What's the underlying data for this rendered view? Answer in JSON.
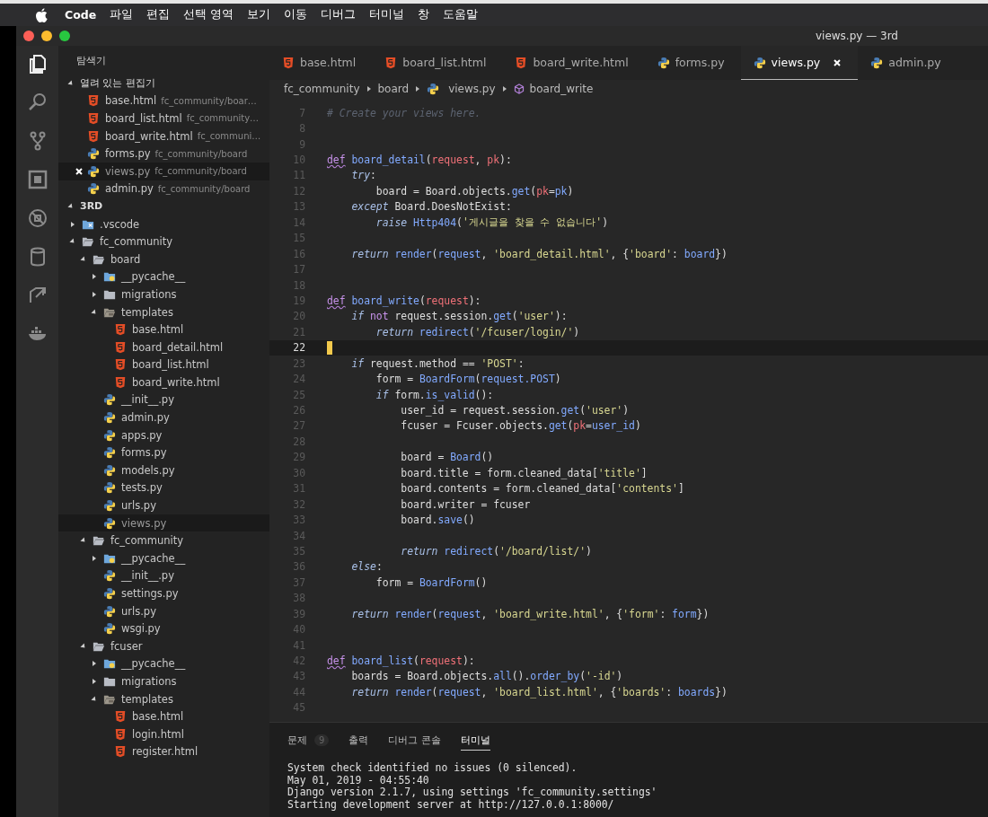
{
  "menu_bar": {
    "items": [
      "Code",
      "파일",
      "편집",
      "선택 영역",
      "보기",
      "이동",
      "디버그",
      "터미널",
      "창",
      "도움말"
    ]
  },
  "window": {
    "title": "views.py — 3rd"
  },
  "activity_bar": [
    {
      "kind": "files",
      "selected": true
    },
    {
      "kind": "search",
      "selected": false
    },
    {
      "kind": "source-control",
      "selected": false
    },
    {
      "kind": "extensions",
      "selected": false
    },
    {
      "kind": "debug",
      "selected": false
    },
    {
      "kind": "database",
      "selected": false
    },
    {
      "kind": "share",
      "selected": false
    },
    {
      "kind": "docker",
      "selected": false
    }
  ],
  "sidebar": {
    "title": "탐색기",
    "open_editors": {
      "label": "열려 있는 편집기",
      "expanded": true,
      "items": [
        {
          "name": "base.html",
          "path": "fc_community/boar…",
          "kind": "html",
          "selected": false
        },
        {
          "name": "board_list.html",
          "path": "fc_community…",
          "kind": "html",
          "selected": false
        },
        {
          "name": "board_write.html",
          "path": "fc_communi…",
          "kind": "html",
          "selected": false
        },
        {
          "name": "forms.py",
          "path": "fc_community/board",
          "kind": "python",
          "selected": false
        },
        {
          "name": "views.py",
          "path": "fc_community/board",
          "kind": "python",
          "selected": true
        },
        {
          "name": "admin.py",
          "path": "fc_community/board",
          "kind": "python",
          "selected": false
        }
      ]
    },
    "workspace": {
      "label": "3RD",
      "expanded": true,
      "children": [
        {
          "name": ".vscode",
          "kind": "folder-vscode",
          "expanded": false,
          "selected": false
        },
        {
          "name": "fc_community",
          "kind": "folder",
          "expanded": true,
          "selected": false,
          "children": [
            {
              "name": "board",
              "kind": "folder",
              "expanded": true,
              "selected": false,
              "children": [
                {
                  "name": "__pycache__",
                  "kind": "folder-python",
                  "expanded": false,
                  "selected": false
                },
                {
                  "name": "migrations",
                  "kind": "folder",
                  "expanded": false,
                  "selected": false
                },
                {
                  "name": "templates",
                  "kind": "folder-templates",
                  "expanded": true,
                  "selected": false,
                  "children": [
                    {
                      "name": "base.html",
                      "kind": "html",
                      "selected": false
                    },
                    {
                      "name": "board_detail.html",
                      "kind": "html",
                      "selected": false
                    },
                    {
                      "name": "board_list.html",
                      "kind": "html",
                      "selected": false
                    },
                    {
                      "name": "board_write.html",
                      "kind": "html",
                      "selected": false
                    }
                  ]
                },
                {
                  "name": "__init__.py",
                  "kind": "python",
                  "selected": false
                },
                {
                  "name": "admin.py",
                  "kind": "python",
                  "selected": false
                },
                {
                  "name": "apps.py",
                  "kind": "python",
                  "selected": false
                },
                {
                  "name": "forms.py",
                  "kind": "python",
                  "selected": false
                },
                {
                  "name": "models.py",
                  "kind": "python",
                  "selected": false
                },
                {
                  "name": "tests.py",
                  "kind": "python",
                  "selected": false
                },
                {
                  "name": "urls.py",
                  "kind": "python",
                  "selected": false
                },
                {
                  "name": "views.py",
                  "kind": "python",
                  "selected": true
                }
              ]
            },
            {
              "name": "fc_community",
              "kind": "folder",
              "expanded": true,
              "selected": false,
              "children": [
                {
                  "name": "__pycache__",
                  "kind": "folder-python",
                  "expanded": false,
                  "selected": false
                },
                {
                  "name": "__init__.py",
                  "kind": "python",
                  "selected": false
                },
                {
                  "name": "settings.py",
                  "kind": "python",
                  "selected": false
                },
                {
                  "name": "urls.py",
                  "kind": "python",
                  "selected": false
                },
                {
                  "name": "wsgi.py",
                  "kind": "python",
                  "selected": false
                }
              ]
            },
            {
              "name": "fcuser",
              "kind": "folder",
              "expanded": true,
              "selected": false,
              "children": [
                {
                  "name": "__pycache__",
                  "kind": "folder-python",
                  "expanded": false,
                  "selected": false
                },
                {
                  "name": "migrations",
                  "kind": "folder",
                  "expanded": false,
                  "selected": false
                },
                {
                  "name": "templates",
                  "kind": "folder-templates",
                  "expanded": true,
                  "selected": false,
                  "children": [
                    {
                      "name": "base.html",
                      "kind": "html",
                      "selected": false
                    },
                    {
                      "name": "login.html",
                      "kind": "html",
                      "selected": false
                    },
                    {
                      "name": "register.html",
                      "kind": "html",
                      "selected": false
                    }
                  ]
                }
              ]
            }
          ]
        }
      ]
    }
  },
  "tabs": [
    {
      "label": "base.html",
      "kind": "html",
      "selected": false
    },
    {
      "label": "board_list.html",
      "kind": "html",
      "selected": false
    },
    {
      "label": "board_write.html",
      "kind": "html",
      "selected": false
    },
    {
      "label": "forms.py",
      "kind": "python",
      "selected": false
    },
    {
      "label": "views.py",
      "kind": "python",
      "selected": true
    },
    {
      "label": "admin.py",
      "kind": "python",
      "selected": false
    }
  ],
  "breadcrumb": [
    {
      "label": "fc_community",
      "kind": "folder"
    },
    {
      "label": "board",
      "kind": "folder"
    },
    {
      "label": "views.py",
      "kind": "python"
    },
    {
      "label": "board_write",
      "kind": "symbol"
    }
  ],
  "editor": {
    "lines": [
      {
        "n": "7",
        "tokens": [
          {
            "text": "# Create your views here.",
            "kind": "comment"
          }
        ]
      },
      {
        "n": "8"
      },
      {
        "n": "9"
      },
      {
        "n": "10",
        "tokens": [
          {
            "text": "def",
            "kind": "def"
          },
          {
            "text": " board_detail",
            "kind": "fn"
          },
          {
            "text": "(",
            "kind": "plain"
          },
          {
            "text": "request",
            "kind": "param"
          },
          {
            "text": ", ",
            "kind": "plain"
          },
          {
            "text": "pk",
            "kind": "param"
          },
          {
            "text": "):",
            "kind": "plain"
          }
        ]
      },
      {
        "n": "11",
        "tokens": [
          {
            "text": "    try",
            "kind": "ctl"
          },
          {
            "text": ":",
            "kind": "plain"
          }
        ]
      },
      {
        "n": "12",
        "tokens": [
          {
            "text": "        board = Board.objects.",
            "kind": "plain"
          },
          {
            "text": "get",
            "kind": "fn"
          },
          {
            "text": "(",
            "kind": "plain"
          },
          {
            "text": "pk",
            "kind": "param"
          },
          {
            "text": "=",
            "kind": "plain"
          },
          {
            "text": "pk",
            "kind": "fn"
          },
          {
            "text": ")",
            "kind": "plain"
          }
        ]
      },
      {
        "n": "13",
        "tokens": [
          {
            "text": "    except",
            "kind": "ctl"
          },
          {
            "text": " Board.DoesNotExist:",
            "kind": "plain"
          }
        ]
      },
      {
        "n": "14",
        "tokens": [
          {
            "text": "        raise",
            "kind": "ctl"
          },
          {
            "text": " Http404",
            "kind": "fn"
          },
          {
            "text": "(",
            "kind": "plain"
          },
          {
            "text": "'게시글을 찾을 수 없습니다'",
            "kind": "str"
          },
          {
            "text": ")",
            "kind": "plain"
          }
        ]
      },
      {
        "n": "15"
      },
      {
        "n": "16",
        "tokens": [
          {
            "text": "    return",
            "kind": "ctl"
          },
          {
            "text": " render",
            "kind": "fn"
          },
          {
            "text": "(",
            "kind": "plain"
          },
          {
            "text": "request",
            "kind": "fn"
          },
          {
            "text": ", ",
            "kind": "plain"
          },
          {
            "text": "'board_detail.html'",
            "kind": "str"
          },
          {
            "text": ", {",
            "kind": "plain"
          },
          {
            "text": "'board'",
            "kind": "str"
          },
          {
            "text": ": ",
            "kind": "plain"
          },
          {
            "text": "board",
            "kind": "fn"
          },
          {
            "text": "})",
            "kind": "plain"
          }
        ]
      },
      {
        "n": "17"
      },
      {
        "n": "18"
      },
      {
        "n": "19",
        "tokens": [
          {
            "text": "def",
            "kind": "def"
          },
          {
            "text": " board_write",
            "kind": "fn"
          },
          {
            "text": "(",
            "kind": "plain"
          },
          {
            "text": "request",
            "kind": "param"
          },
          {
            "text": "):",
            "kind": "plain"
          }
        ]
      },
      {
        "n": "20",
        "tokens": [
          {
            "text": "    if",
            "kind": "ctl"
          },
          {
            "text": " not",
            "kind": "op"
          },
          {
            "text": " request.session.",
            "kind": "plain"
          },
          {
            "text": "get",
            "kind": "fn"
          },
          {
            "text": "(",
            "kind": "plain"
          },
          {
            "text": "'user'",
            "kind": "str"
          },
          {
            "text": "):",
            "kind": "plain"
          }
        ]
      },
      {
        "n": "21",
        "tokens": [
          {
            "text": "        return",
            "kind": "ctl"
          },
          {
            "text": " redirect",
            "kind": "fn"
          },
          {
            "text": "(",
            "kind": "plain"
          },
          {
            "text": "'/fcuser/login/'",
            "kind": "str"
          },
          {
            "text": ")",
            "kind": "plain"
          }
        ]
      },
      {
        "n": "22",
        "current": true
      },
      {
        "n": "23",
        "tokens": [
          {
            "text": "    if",
            "kind": "ctl"
          },
          {
            "text": " request.method == ",
            "kind": "plain"
          },
          {
            "text": "'POST'",
            "kind": "str"
          },
          {
            "text": ":",
            "kind": "plain"
          }
        ]
      },
      {
        "n": "24",
        "tokens": [
          {
            "text": "        form = ",
            "kind": "plain"
          },
          {
            "text": "BoardForm",
            "kind": "fn"
          },
          {
            "text": "(",
            "kind": "plain"
          },
          {
            "text": "request.POST",
            "kind": "fn"
          },
          {
            "text": ")",
            "kind": "plain"
          }
        ]
      },
      {
        "n": "25",
        "tokens": [
          {
            "text": "        if",
            "kind": "ctl"
          },
          {
            "text": " form.",
            "kind": "plain"
          },
          {
            "text": "is_valid",
            "kind": "fn"
          },
          {
            "text": "():",
            "kind": "plain"
          }
        ]
      },
      {
        "n": "26",
        "tokens": [
          {
            "text": "            user_id = request.session.",
            "kind": "plain"
          },
          {
            "text": "get",
            "kind": "fn"
          },
          {
            "text": "(",
            "kind": "plain"
          },
          {
            "text": "'user'",
            "kind": "str"
          },
          {
            "text": ")",
            "kind": "plain"
          }
        ]
      },
      {
        "n": "27",
        "tokens": [
          {
            "text": "            fcuser = Fcuser.objects.",
            "kind": "plain"
          },
          {
            "text": "get",
            "kind": "fn"
          },
          {
            "text": "(",
            "kind": "plain"
          },
          {
            "text": "pk",
            "kind": "param"
          },
          {
            "text": "=",
            "kind": "plain"
          },
          {
            "text": "user_id",
            "kind": "fn"
          },
          {
            "text": ")",
            "kind": "plain"
          }
        ]
      },
      {
        "n": "28"
      },
      {
        "n": "29",
        "tokens": [
          {
            "text": "            board = ",
            "kind": "plain"
          },
          {
            "text": "Board",
            "kind": "fn"
          },
          {
            "text": "()",
            "kind": "plain"
          }
        ]
      },
      {
        "n": "30",
        "tokens": [
          {
            "text": "            board.title = form.cleaned_data[",
            "kind": "plain"
          },
          {
            "text": "'title'",
            "kind": "str"
          },
          {
            "text": "]",
            "kind": "plain"
          }
        ]
      },
      {
        "n": "31",
        "tokens": [
          {
            "text": "            board.contents = form.cleaned_data[",
            "kind": "plain"
          },
          {
            "text": "'contents'",
            "kind": "str"
          },
          {
            "text": "]",
            "kind": "plain"
          }
        ]
      },
      {
        "n": "32",
        "tokens": [
          {
            "text": "            board.writer = fcuser",
            "kind": "plain"
          }
        ]
      },
      {
        "n": "33",
        "tokens": [
          {
            "text": "            board.",
            "kind": "plain"
          },
          {
            "text": "save",
            "kind": "fn"
          },
          {
            "text": "()",
            "kind": "plain"
          }
        ]
      },
      {
        "n": "34"
      },
      {
        "n": "35",
        "tokens": [
          {
            "text": "            return",
            "kind": "ctl"
          },
          {
            "text": " redirect",
            "kind": "fn"
          },
          {
            "text": "(",
            "kind": "plain"
          },
          {
            "text": "'/board/list/'",
            "kind": "str"
          },
          {
            "text": ")",
            "kind": "plain"
          }
        ]
      },
      {
        "n": "36",
        "tokens": [
          {
            "text": "    else",
            "kind": "ctl"
          },
          {
            "text": ":",
            "kind": "plain"
          }
        ]
      },
      {
        "n": "37",
        "tokens": [
          {
            "text": "        form = ",
            "kind": "plain"
          },
          {
            "text": "BoardForm",
            "kind": "fn"
          },
          {
            "text": "()",
            "kind": "plain"
          }
        ]
      },
      {
        "n": "38"
      },
      {
        "n": "39",
        "tokens": [
          {
            "text": "    return",
            "kind": "ctl"
          },
          {
            "text": " render",
            "kind": "fn"
          },
          {
            "text": "(",
            "kind": "plain"
          },
          {
            "text": "request",
            "kind": "fn"
          },
          {
            "text": ", ",
            "kind": "plain"
          },
          {
            "text": "'board_write.html'",
            "kind": "str"
          },
          {
            "text": ", {",
            "kind": "plain"
          },
          {
            "text": "'form'",
            "kind": "str"
          },
          {
            "text": ": ",
            "kind": "plain"
          },
          {
            "text": "form",
            "kind": "fn"
          },
          {
            "text": "})",
            "kind": "plain"
          }
        ]
      },
      {
        "n": "40"
      },
      {
        "n": "41"
      },
      {
        "n": "42",
        "tokens": [
          {
            "text": "def",
            "kind": "def"
          },
          {
            "text": " board_list",
            "kind": "fn"
          },
          {
            "text": "(",
            "kind": "plain"
          },
          {
            "text": "request",
            "kind": "param"
          },
          {
            "text": "):",
            "kind": "plain"
          }
        ]
      },
      {
        "n": "43",
        "tokens": [
          {
            "text": "    boards = Board.objects.",
            "kind": "plain"
          },
          {
            "text": "all",
            "kind": "fn"
          },
          {
            "text": "().",
            "kind": "plain"
          },
          {
            "text": "order_by",
            "kind": "fn"
          },
          {
            "text": "(",
            "kind": "plain"
          },
          {
            "text": "'-id'",
            "kind": "str"
          },
          {
            "text": ")",
            "kind": "plain"
          }
        ]
      },
      {
        "n": "44",
        "tokens": [
          {
            "text": "    return",
            "kind": "ctl"
          },
          {
            "text": " render",
            "kind": "fn"
          },
          {
            "text": "(",
            "kind": "plain"
          },
          {
            "text": "request",
            "kind": "fn"
          },
          {
            "text": ", ",
            "kind": "plain"
          },
          {
            "text": "'board_list.html'",
            "kind": "str"
          },
          {
            "text": ", {",
            "kind": "plain"
          },
          {
            "text": "'boards'",
            "kind": "str"
          },
          {
            "text": ": ",
            "kind": "plain"
          },
          {
            "text": "boards",
            "kind": "fn"
          },
          {
            "text": "})",
            "kind": "plain"
          }
        ]
      },
      {
        "n": "45"
      }
    ]
  },
  "panel": {
    "tabs": [
      {
        "label": "문제",
        "badge": "9",
        "selected": false
      },
      {
        "label": "출력",
        "selected": false
      },
      {
        "label": "디버그 콘솔",
        "selected": false
      },
      {
        "label": "터미널",
        "selected": true
      }
    ],
    "terminal": [
      "System check identified no issues (0 silenced).",
      "May 01, 2019 - 04:55:40",
      "Django version 2.1.7, using settings 'fc_community.settings'",
      "Starting development server at http://127.0.0.1:8000/"
    ]
  }
}
